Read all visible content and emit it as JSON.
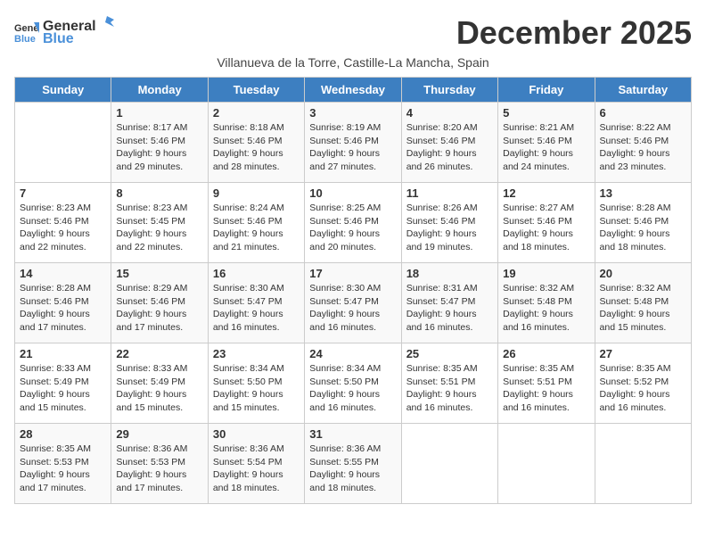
{
  "logo": {
    "text_general": "General",
    "text_blue": "Blue"
  },
  "title": "December 2025",
  "subtitle": "Villanueva de la Torre, Castille-La Mancha, Spain",
  "days_of_week": [
    "Sunday",
    "Monday",
    "Tuesday",
    "Wednesday",
    "Thursday",
    "Friday",
    "Saturday"
  ],
  "weeks": [
    [
      {
        "day": "",
        "info": ""
      },
      {
        "day": "1",
        "info": "Sunrise: 8:17 AM\nSunset: 5:46 PM\nDaylight: 9 hours\nand 29 minutes."
      },
      {
        "day": "2",
        "info": "Sunrise: 8:18 AM\nSunset: 5:46 PM\nDaylight: 9 hours\nand 28 minutes."
      },
      {
        "day": "3",
        "info": "Sunrise: 8:19 AM\nSunset: 5:46 PM\nDaylight: 9 hours\nand 27 minutes."
      },
      {
        "day": "4",
        "info": "Sunrise: 8:20 AM\nSunset: 5:46 PM\nDaylight: 9 hours\nand 26 minutes."
      },
      {
        "day": "5",
        "info": "Sunrise: 8:21 AM\nSunset: 5:46 PM\nDaylight: 9 hours\nand 24 minutes."
      },
      {
        "day": "6",
        "info": "Sunrise: 8:22 AM\nSunset: 5:46 PM\nDaylight: 9 hours\nand 23 minutes."
      }
    ],
    [
      {
        "day": "7",
        "info": "Sunrise: 8:23 AM\nSunset: 5:46 PM\nDaylight: 9 hours\nand 22 minutes."
      },
      {
        "day": "8",
        "info": "Sunrise: 8:23 AM\nSunset: 5:45 PM\nDaylight: 9 hours\nand 22 minutes."
      },
      {
        "day": "9",
        "info": "Sunrise: 8:24 AM\nSunset: 5:46 PM\nDaylight: 9 hours\nand 21 minutes."
      },
      {
        "day": "10",
        "info": "Sunrise: 8:25 AM\nSunset: 5:46 PM\nDaylight: 9 hours\nand 20 minutes."
      },
      {
        "day": "11",
        "info": "Sunrise: 8:26 AM\nSunset: 5:46 PM\nDaylight: 9 hours\nand 19 minutes."
      },
      {
        "day": "12",
        "info": "Sunrise: 8:27 AM\nSunset: 5:46 PM\nDaylight: 9 hours\nand 18 minutes."
      },
      {
        "day": "13",
        "info": "Sunrise: 8:28 AM\nSunset: 5:46 PM\nDaylight: 9 hours\nand 18 minutes."
      }
    ],
    [
      {
        "day": "14",
        "info": "Sunrise: 8:28 AM\nSunset: 5:46 PM\nDaylight: 9 hours\nand 17 minutes."
      },
      {
        "day": "15",
        "info": "Sunrise: 8:29 AM\nSunset: 5:46 PM\nDaylight: 9 hours\nand 17 minutes."
      },
      {
        "day": "16",
        "info": "Sunrise: 8:30 AM\nSunset: 5:47 PM\nDaylight: 9 hours\nand 16 minutes."
      },
      {
        "day": "17",
        "info": "Sunrise: 8:30 AM\nSunset: 5:47 PM\nDaylight: 9 hours\nand 16 minutes."
      },
      {
        "day": "18",
        "info": "Sunrise: 8:31 AM\nSunset: 5:47 PM\nDaylight: 9 hours\nand 16 minutes."
      },
      {
        "day": "19",
        "info": "Sunrise: 8:32 AM\nSunset: 5:48 PM\nDaylight: 9 hours\nand 16 minutes."
      },
      {
        "day": "20",
        "info": "Sunrise: 8:32 AM\nSunset: 5:48 PM\nDaylight: 9 hours\nand 15 minutes."
      }
    ],
    [
      {
        "day": "21",
        "info": "Sunrise: 8:33 AM\nSunset: 5:49 PM\nDaylight: 9 hours\nand 15 minutes."
      },
      {
        "day": "22",
        "info": "Sunrise: 8:33 AM\nSunset: 5:49 PM\nDaylight: 9 hours\nand 15 minutes."
      },
      {
        "day": "23",
        "info": "Sunrise: 8:34 AM\nSunset: 5:50 PM\nDaylight: 9 hours\nand 15 minutes."
      },
      {
        "day": "24",
        "info": "Sunrise: 8:34 AM\nSunset: 5:50 PM\nDaylight: 9 hours\nand 16 minutes."
      },
      {
        "day": "25",
        "info": "Sunrise: 8:35 AM\nSunset: 5:51 PM\nDaylight: 9 hours\nand 16 minutes."
      },
      {
        "day": "26",
        "info": "Sunrise: 8:35 AM\nSunset: 5:51 PM\nDaylight: 9 hours\nand 16 minutes."
      },
      {
        "day": "27",
        "info": "Sunrise: 8:35 AM\nSunset: 5:52 PM\nDaylight: 9 hours\nand 16 minutes."
      }
    ],
    [
      {
        "day": "28",
        "info": "Sunrise: 8:35 AM\nSunset: 5:53 PM\nDaylight: 9 hours\nand 17 minutes."
      },
      {
        "day": "29",
        "info": "Sunrise: 8:36 AM\nSunset: 5:53 PM\nDaylight: 9 hours\nand 17 minutes."
      },
      {
        "day": "30",
        "info": "Sunrise: 8:36 AM\nSunset: 5:54 PM\nDaylight: 9 hours\nand 18 minutes."
      },
      {
        "day": "31",
        "info": "Sunrise: 8:36 AM\nSunset: 5:55 PM\nDaylight: 9 hours\nand 18 minutes."
      },
      {
        "day": "",
        "info": ""
      },
      {
        "day": "",
        "info": ""
      },
      {
        "day": "",
        "info": ""
      }
    ]
  ]
}
